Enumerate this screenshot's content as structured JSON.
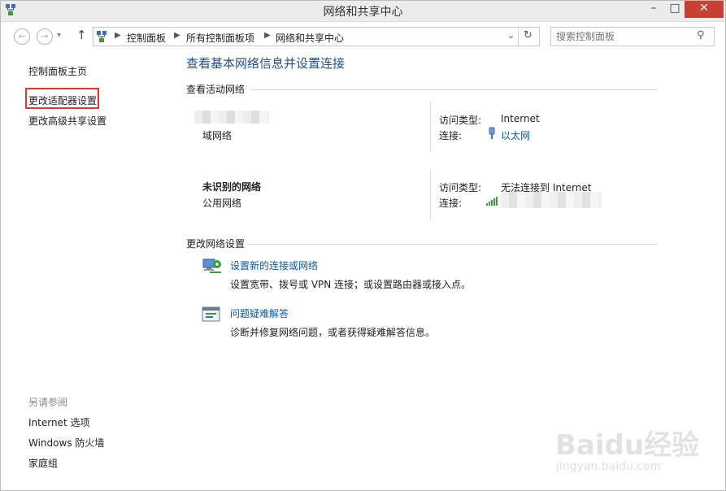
{
  "window": {
    "title": "网络和共享中心"
  },
  "breadcrumbs": [
    "控制面板",
    "所有控制面板项",
    "网络和共享中心"
  ],
  "search": {
    "placeholder": "搜索控制面板"
  },
  "sidebar": {
    "items": [
      {
        "label": "控制面板主页"
      },
      {
        "label": "更改适配器设置"
      },
      {
        "label": "更改高级共享设置"
      }
    ],
    "see_also_title": "另请参阅",
    "see_also": [
      {
        "label": "Internet 选项"
      },
      {
        "label": "Windows 防火墙"
      },
      {
        "label": "家庭组"
      }
    ]
  },
  "main": {
    "heading": "查看基本网络信息并设置连接",
    "active_networks_title": "查看活动网络",
    "networks": [
      {
        "name": "",
        "type": "域网络",
        "access_label": "访问类型:",
        "access_value": "Internet",
        "conn_label": "连接:",
        "conn_value": "以太网"
      },
      {
        "name": "未识别的网络",
        "type": "公用网络",
        "access_label": "访问类型:",
        "access_value": "无法连接到 Internet",
        "conn_label": "连接:",
        "conn_value": ""
      }
    ],
    "change_settings_title": "更改网络设置",
    "tasks": [
      {
        "title": "设置新的连接或网络",
        "desc": "设置宽带、拨号或 VPN 连接；或设置路由器或接入点。",
        "icon": "network-setup-icon"
      },
      {
        "title": "问题疑难解答",
        "desc": "诊断并修复网络问题，或者获得疑难解答信息。",
        "icon": "troubleshoot-icon"
      }
    ]
  },
  "watermark": {
    "brand": "Baidu经验",
    "url": "jingyan.baidu.com"
  }
}
